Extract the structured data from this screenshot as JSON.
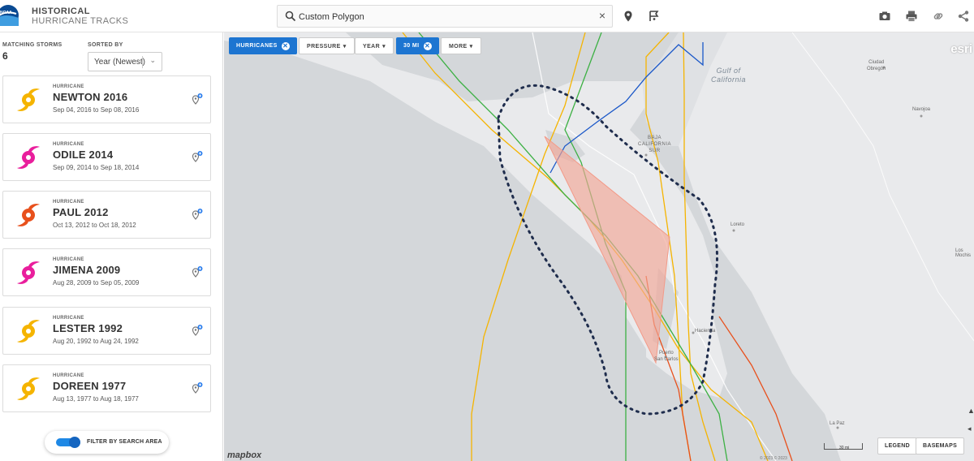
{
  "header": {
    "title_line1": "HISTORICAL",
    "title_line2": "HURRICANE TRACKS",
    "logo_text": "NOAA",
    "search_value": "Custom Polygon",
    "clear_symbol": "×",
    "icons": [
      "search-icon",
      "location-pin-icon",
      "custom-area-flag-icon",
      "camera-icon",
      "print-icon",
      "link-icon",
      "share-icon"
    ]
  },
  "sidebar": {
    "matching_label": "MATCHING STORMS",
    "matching_count": "6",
    "sorted_label": "SORTED BY",
    "sort_value": "Year (Newest)",
    "storms": [
      {
        "type": "HURRICANE",
        "name": "NEWTON 2016",
        "dates": "Sep 04, 2016 to Sep 08, 2016",
        "color": "#f5b400"
      },
      {
        "type": "HURRICANE",
        "name": "ODILE 2014",
        "dates": "Sep 09, 2014 to Sep 18, 2014",
        "color": "#e91e9c"
      },
      {
        "type": "HURRICANE",
        "name": "PAUL 2012",
        "dates": "Oct 13, 2012 to Oct 18, 2012",
        "color": "#e8501c"
      },
      {
        "type": "HURRICANE",
        "name": "JIMENA 2009",
        "dates": "Aug 28, 2009 to Sep 05, 2009",
        "color": "#e91e9c"
      },
      {
        "type": "HURRICANE",
        "name": "LESTER 1992",
        "dates": "Aug 20, 1992 to Aug 24, 1992",
        "color": "#f5b400"
      },
      {
        "type": "HURRICANE",
        "name": "DOREEN 1977",
        "dates": "Aug 13, 1977 to Aug 18, 1977",
        "color": "#f5b400"
      }
    ],
    "filter_toggle_label": "FILTER BY SEARCH AREA",
    "filter_toggle_on": true
  },
  "map": {
    "filters": {
      "hurricanes": "HURRICANES",
      "pressure": "PRESSURE",
      "year": "YEAR",
      "distance": "30 MI",
      "more": "MORE"
    },
    "labels": {
      "gulf_line1": "Gulf of",
      "gulf_line2": "California",
      "ciudad_obregon_1": "Ciudad",
      "ciudad_obregon_2": "Obregón",
      "navojoa": "Navojoa",
      "baja_california_1": "BAJA",
      "baja_california_2": "CALIFORNIA",
      "baja_california_3": "SUR",
      "loreto": "Loreto",
      "hacienda": "Hacienda",
      "puerto_san_carlos_1": "Puerto",
      "puerto_san_carlos_2": "San Carlos",
      "la_paz": "La Paz",
      "los_mochis": "Los Mochis"
    },
    "buttons": {
      "legend": "LEGEND",
      "basemaps": "BASEMAPS"
    },
    "scale_label": "30 mi",
    "attribution_mapbox": "mapbox",
    "attribution_esri": "esri",
    "attribution_credits": "© 2023 © 2023",
    "track_colors": {
      "tropical_storm": "#f5b400",
      "depression": "#3cb043",
      "cat1": "#e8501c",
      "unknown": "#1a57c8"
    },
    "polygon_color": "#f3a696",
    "search_area_color": "#1f2d4d"
  }
}
